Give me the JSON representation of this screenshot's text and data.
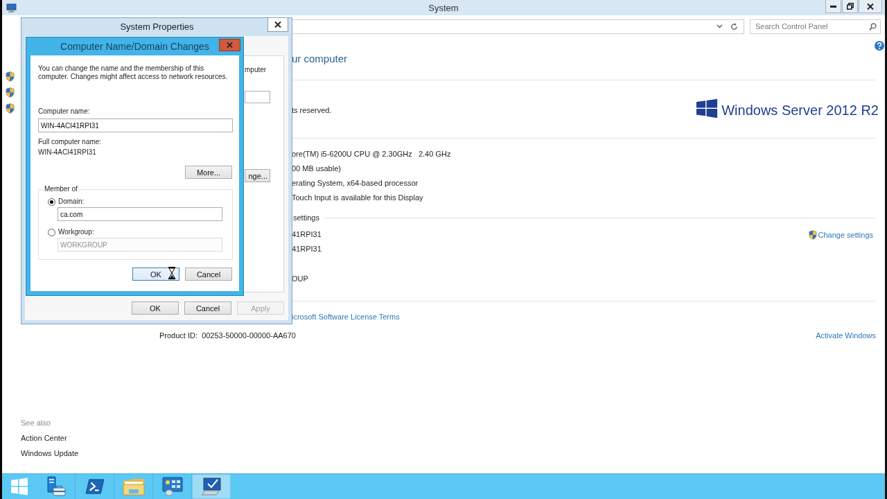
{
  "system_window": {
    "title": "System",
    "search": {
      "placeholder": "Search Control Panel"
    },
    "heading": "ur computer",
    "copyright": "ts reserved.",
    "edition_logo": "Windows Server 2012 R2",
    "system_rows": [
      "ore(TM) i5-6200U CPU @ 2.30GHz   2.40 GHz",
      "00 MB usable)",
      "erating System, x64-based processor",
      "Touch Input is available for this Display"
    ],
    "name_section": {
      "heading": "settings",
      "rows": [
        "41RPI31",
        "41RPI31"
      ],
      "last_row": "OUP",
      "change_link": "Change settings"
    },
    "license_link": "icrosoft Software License Terms",
    "product_id": "Product ID:  00253-50000-00000-AA670",
    "activate_link": "Activate Windows",
    "see_also": {
      "heading": "See also",
      "links": [
        "Action Center",
        "Windows Update"
      ]
    }
  },
  "system_properties": {
    "title": "System Properties",
    "panel_text": "mputer",
    "panel_button": "nge...",
    "buttons": [
      {
        "label": "OK",
        "disabled": false
      },
      {
        "label": "Cancel",
        "disabled": false
      },
      {
        "label": "Apply",
        "disabled": true
      }
    ]
  },
  "name_dialog": {
    "title": "Computer Name/Domain Changes",
    "intro": "You can change the name and the membership of this computer. Changes might affect access to network resources.",
    "computer_name": {
      "label": "Computer name:",
      "value": "WIN-4ACI41RPI31"
    },
    "full_name": {
      "label": "Full computer name:",
      "value": "WIN-4ACI41RPI31"
    },
    "more_button": "More...",
    "member_of": {
      "title": "Member of",
      "options": [
        {
          "label": "Domain:",
          "selected": true,
          "value": "ca.com",
          "disabled": false
        },
        {
          "label": "Workgroup:",
          "selected": false,
          "value": "WORKGROUP",
          "disabled": true
        }
      ]
    },
    "buttons": [
      {
        "label": "OK",
        "focused": true
      },
      {
        "label": "Cancel",
        "focused": false
      }
    ]
  },
  "taskbar": {
    "apps": [
      {
        "kind": "server_manager",
        "selected": false
      },
      {
        "kind": "powershell",
        "selected": false
      },
      {
        "kind": "explorer",
        "selected": false
      },
      {
        "kind": "control_panel",
        "selected": false
      },
      {
        "kind": "system",
        "selected": true
      }
    ]
  }
}
